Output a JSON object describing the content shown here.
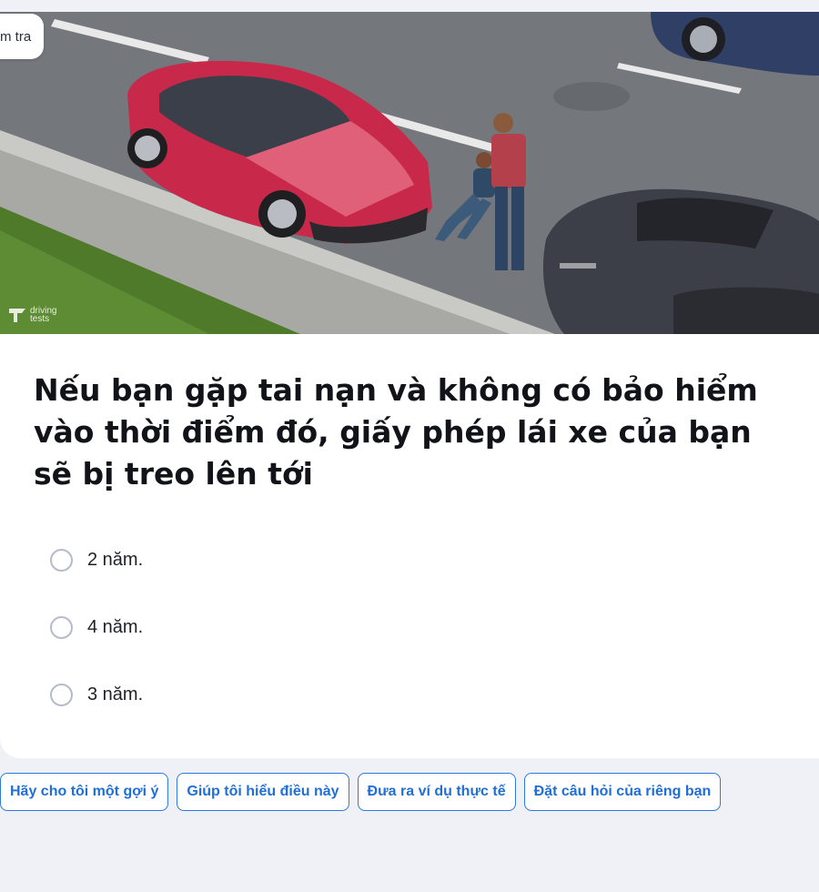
{
  "header": {
    "tag_label": "m tra"
  },
  "image": {
    "logo_text": "driving\ntests"
  },
  "question": {
    "text": "Nếu bạn gặp tai nạn và không có bảo hiểm vào thời điểm đó, giấy phép lái xe của bạn sẽ bị treo lên tới"
  },
  "options": [
    {
      "label": "2 năm."
    },
    {
      "label": "4 năm."
    },
    {
      "label": "3 năm."
    }
  ],
  "actions": [
    {
      "label": "Hãy cho tôi một gợi ý"
    },
    {
      "label": "Giúp tôi hiểu điều này"
    },
    {
      "label": "Đưa ra ví dụ thực tế"
    },
    {
      "label": "Đặt câu hỏi của riêng bạn"
    }
  ],
  "colors": {
    "accent": "#2b7be0",
    "page_background": "#eff1f6",
    "card_background": "#ffffff"
  }
}
